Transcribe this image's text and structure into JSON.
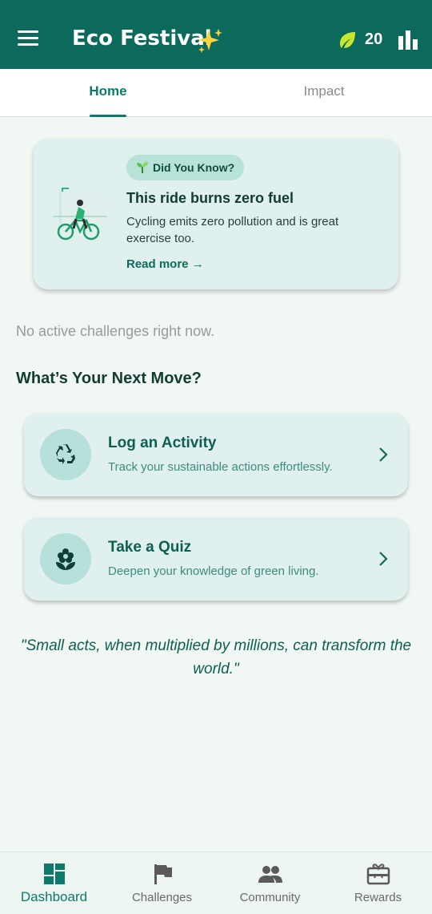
{
  "app": {
    "title": "Eco Festival",
    "points": "20",
    "colors": {
      "primary": "#0b6a5b",
      "accent": "#0b7a6a",
      "card": "#dff0ee",
      "leaf": "#c8e62d"
    }
  },
  "icons": {
    "menu": "menu-icon",
    "sparkle": "sparkle-icon",
    "leaf": "leaf-icon",
    "stats": "bar-chart-icon"
  },
  "tabs": [
    {
      "label": "Home",
      "active": true
    },
    {
      "label": "Impact",
      "active": false
    }
  ],
  "fact_card": {
    "badge": "Did You Know?",
    "title": "This ride burns zero fuel",
    "body": "Cycling emits zero pollution and is great exercise too.",
    "link": "Read more →"
  },
  "empty_state": "No active challenges right now.",
  "section_title": "What’s Your Next Move?",
  "actions": [
    {
      "title": "Log an Activity",
      "subtitle": "Track your sustainable actions effortlessly.",
      "icon": "recycle-icon"
    },
    {
      "title": "Take a Quiz",
      "subtitle": "Deepen your knowledge of green living.",
      "icon": "flower-icon"
    }
  ],
  "quote": "\"Small acts, when multiplied by millions, can transform the world.\"",
  "bottom_nav": [
    {
      "label": "Dashboard",
      "icon": "dashboard-icon",
      "active": true
    },
    {
      "label": "Challenges",
      "icon": "flag-icon",
      "active": false
    },
    {
      "label": "Community",
      "icon": "people-icon",
      "active": false
    },
    {
      "label": "Rewards",
      "icon": "gift-card-icon",
      "active": false
    }
  ]
}
